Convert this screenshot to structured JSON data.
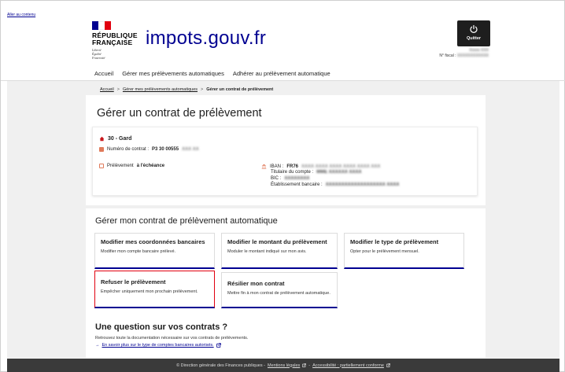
{
  "skip_link": "Aller au contenu",
  "header": {
    "republic_lines": [
      "RÉPUBLIQUE",
      "FRANÇAISE"
    ],
    "motto_lines": [
      "Liberté",
      "Égalité",
      "Fraternité"
    ],
    "brand": "impots.gouv.fr",
    "quit_label": "Quitter",
    "user_name": "Xxxxx XXX",
    "fiscal_label": "N° fiscal :",
    "fiscal_value": "XXXXXXXXXXXX",
    "flag_colors": [
      "#000091",
      "#ffffff",
      "#e1000f"
    ]
  },
  "nav": {
    "items": [
      "Accueil",
      "Gérer mes prélèvements automatiques",
      "Adhérer au prélèvement automatique"
    ]
  },
  "breadcrumb": {
    "items": [
      "Accueil",
      "Gérer mes prélèvements automatiques",
      "Gérer un contrat de prélèvement"
    ],
    "separator": ">"
  },
  "page_title": "Gérer un contrat de prélèvement",
  "contract": {
    "name": "30 - Gard",
    "number_label": "Numéro de contrat :",
    "number_value": "P3 30 00555",
    "number_hidden": "XXX XX",
    "mode_prefix": "Prélèvement",
    "mode_bold": "à l'échéance",
    "iban_label": "IBAN :",
    "iban_prefix": "FR76",
    "iban_hidden": "XXXX XXXX XXXX XXXX XXXX XXX",
    "holder_label": "Titulaire du compte :",
    "holder_value": "MME XXXXXX XXXX",
    "bic_label": "BIC :",
    "bic_value": "XXXXXXXX",
    "bank_label": "Établissement bancaire :",
    "bank_value": "XXXXXXXXXXXXXXXXXXX XXXX"
  },
  "manage_title": "Gérer mon contrat de prélèvement automatique",
  "tiles": [
    {
      "title": "Modifier mes coordonnées bancaires",
      "desc": "Modifier mon compte bancaire prélevé."
    },
    {
      "title": "Modifier le montant du prélèvement",
      "desc": "Moduler le montant indiqué sur mon avis."
    },
    {
      "title": "Modifier le type de prélèvement",
      "desc": "Opter pour le prélèvement mensuel."
    },
    {
      "title": "Refuser le prélèvement",
      "desc": "Empêcher uniquement mon prochain prélèvement."
    },
    {
      "title": "Résilier mon contrat",
      "desc": "Mettre fin à mon contrat de prélèvement automatique."
    }
  ],
  "question": {
    "title": "Une question sur vos contrats ?",
    "text": "Retrouvez toute la documentation nécessaire sur vos contrats de prélèvements.",
    "link_arrow": "→",
    "link": "En savoir plus sur le type de comptes bancaires autorisés."
  },
  "footer": {
    "copyright": "© Direction générale des Finances publiques -",
    "legal": "Mentions légales",
    "sep": "-",
    "access": "Accessibilité : partiellement conforme"
  },
  "colors": {
    "accent": "#000091",
    "marianne_red": "#e1000f",
    "footer_bg": "#3a3a3a"
  }
}
